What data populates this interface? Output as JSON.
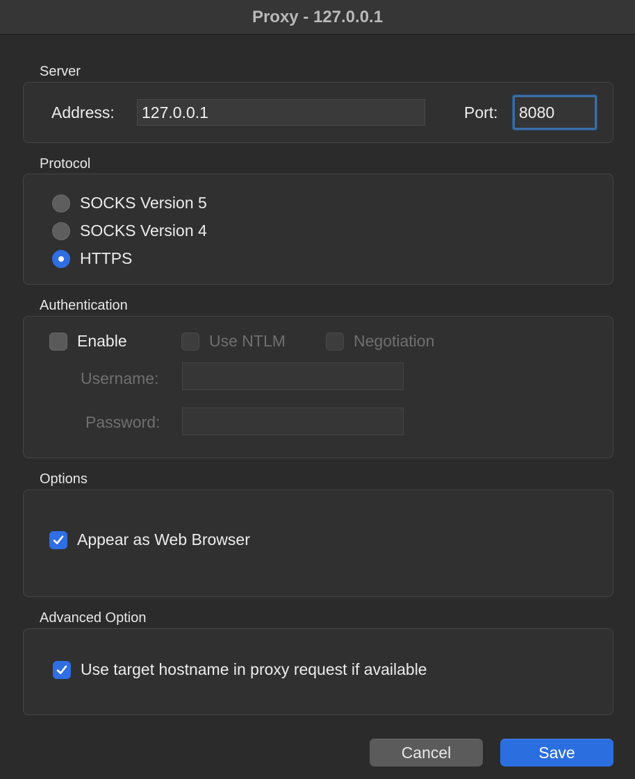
{
  "window": {
    "title": "Proxy - 127.0.0.1"
  },
  "server": {
    "section_label": "Server",
    "address_label": "Address:",
    "address_value": "127.0.0.1",
    "port_label": "Port:",
    "port_value": "8080"
  },
  "protocol": {
    "section_label": "Protocol",
    "options": [
      {
        "label": "SOCKS Version 5",
        "selected": false
      },
      {
        "label": "SOCKS Version 4",
        "selected": false
      },
      {
        "label": "HTTPS",
        "selected": true
      }
    ]
  },
  "authentication": {
    "section_label": "Authentication",
    "enable_label": "Enable",
    "enable_checked": false,
    "use_ntlm_label": "Use NTLM",
    "negotiation_label": "Negotiation",
    "username_label": "Username:",
    "username_value": "",
    "password_label": "Password:",
    "password_value": ""
  },
  "options": {
    "section_label": "Options",
    "appear_as_web_browser_label": "Appear as Web Browser",
    "appear_as_web_browser_checked": true
  },
  "advanced": {
    "section_label": "Advanced Option",
    "use_target_hostname_label": "Use target hostname in proxy request if available",
    "use_target_hostname_checked": true
  },
  "buttons": {
    "cancel_label": "Cancel",
    "save_label": "Save"
  },
  "colors": {
    "accent": "#2b6ee0",
    "background": "#2b2b2b",
    "panel": "#303030"
  }
}
